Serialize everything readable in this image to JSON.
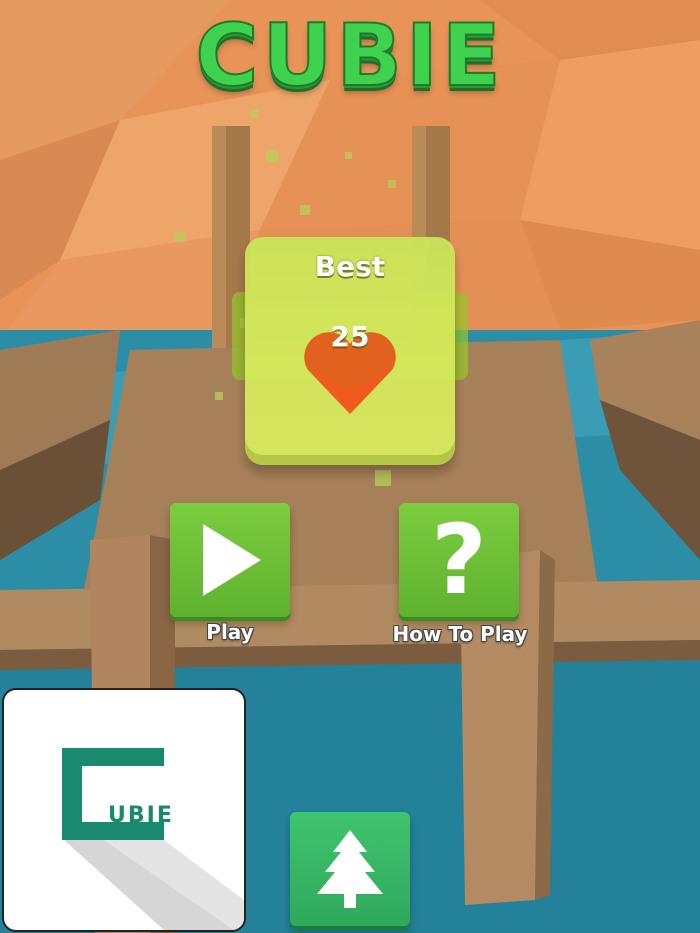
{
  "title": "CUBIE",
  "best": {
    "label": "Best",
    "value": "25"
  },
  "buttons": {
    "play": {
      "label": "Play",
      "icon": "play-triangle-icon"
    },
    "how_to_play": {
      "label": "How To Play",
      "icon": "question-mark-icon",
      "glyph": "?"
    },
    "leaderboard": {
      "icon": "tree-icon"
    }
  },
  "logo": {
    "text": "UBIE",
    "icon": "cubie-logo-icon"
  },
  "colors": {
    "title_green": "#3fd24f",
    "sky_orange": "#e8935a",
    "water_blue": "#2c8ea6",
    "wood": "#a07850",
    "button_green": "#6cbf36",
    "cube_yellow_green": "#d4e85a",
    "heart_orange": "#f05a1e",
    "logo_teal": "#1a8a6e"
  }
}
